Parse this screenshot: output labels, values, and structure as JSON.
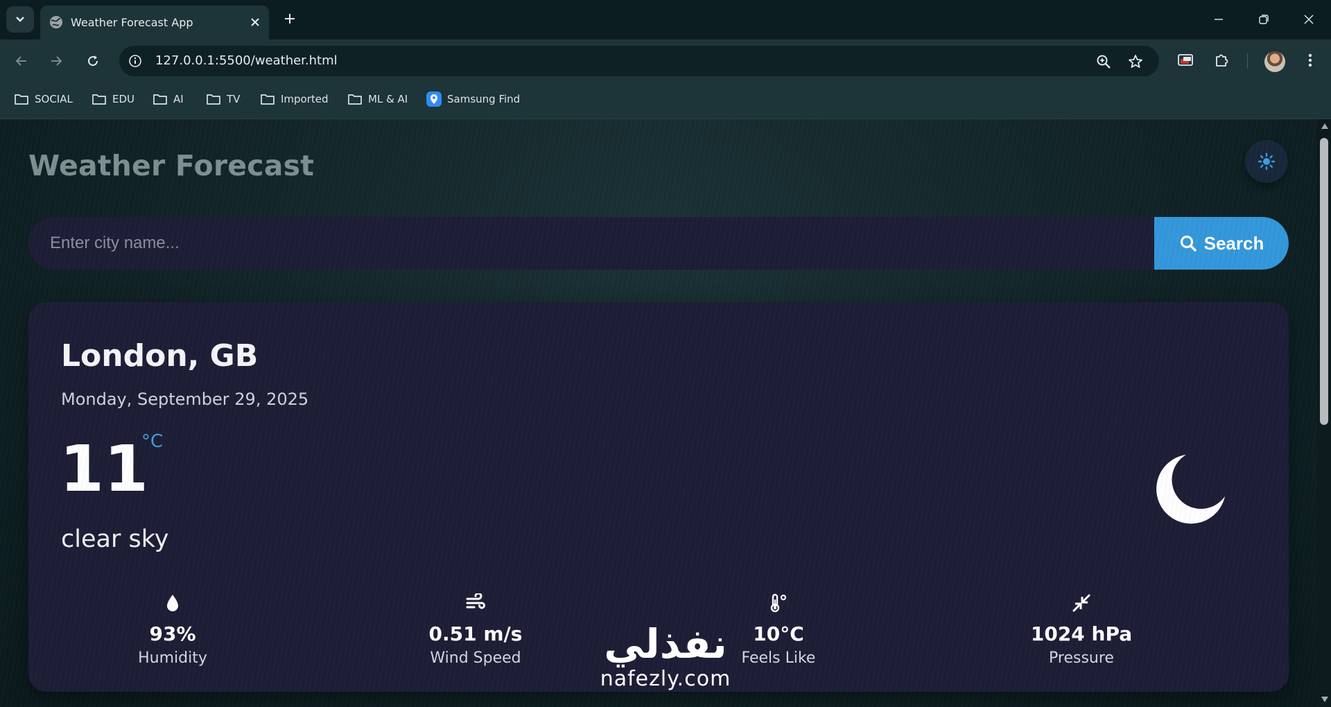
{
  "browser": {
    "tab_title": "Weather Forecast App",
    "url": "127.0.0.1:5500/weather.html",
    "bookmarks": [
      {
        "label": "SOCIAL",
        "icon": "folder-icon"
      },
      {
        "label": "EDU",
        "icon": "folder-icon"
      },
      {
        "label": "AI",
        "icon": "folder-icon"
      },
      {
        "label": "TV",
        "icon": "folder-icon"
      },
      {
        "label": "Imported",
        "icon": "folder-icon"
      },
      {
        "label": "ML & AI",
        "icon": "folder-icon"
      },
      {
        "label": "Samsung Find",
        "icon": "samsung-find-icon"
      }
    ]
  },
  "app": {
    "title": "Weather Forecast",
    "search": {
      "placeholder": "Enter city name...",
      "button_label": "Search"
    }
  },
  "weather": {
    "city": "London, GB",
    "date": "Monday, September 29, 2025",
    "temperature": "11",
    "unit": "°C",
    "description": "clear sky",
    "condition_icon": "moon-icon",
    "stats": [
      {
        "icon": "droplet-icon",
        "value": "93%",
        "label": "Humidity"
      },
      {
        "icon": "wind-icon",
        "value": "0.51 m/s",
        "label": "Wind Speed"
      },
      {
        "icon": "thermometer-icon",
        "value": "10°C",
        "label": "Feels Like"
      },
      {
        "icon": "compress-icon",
        "value": "1024 hPa",
        "label": "Pressure"
      }
    ]
  },
  "watermark": {
    "arabic": "نفذلي",
    "latin": "nafezly.com"
  },
  "colors": {
    "accent": "#3498db",
    "card": "#1d1e36",
    "browser_chrome": "#1d3439"
  }
}
